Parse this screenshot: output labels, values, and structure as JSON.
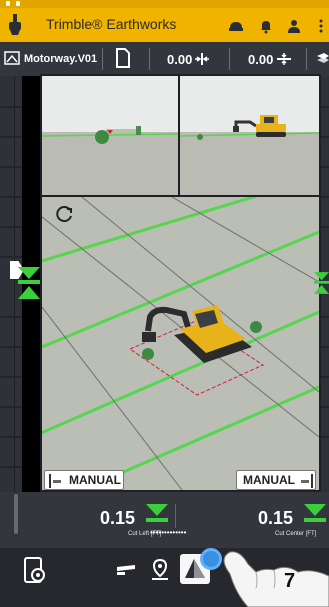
{
  "app": {
    "title": "Trimble® Earthworks"
  },
  "toolbar": {
    "design_name": "Motorway.V01",
    "offset_horizontal": "0.00",
    "offset_vertical": "0.00"
  },
  "views": {
    "left_mode": "MANUAL",
    "right_mode": "MANUAL"
  },
  "readouts": {
    "cut_left_value": "0.15",
    "cut_left_label": "Cut Left [FT]",
    "cut_center_value": "0.15",
    "cut_center_label": "Cut Center [FT]",
    "dots": "•••••••••••••"
  },
  "nav": {
    "step_number": "7"
  },
  "colors": {
    "brand": "#f0b300",
    "toolbar": "#33363d",
    "cut_arrow": "#3ccf3c",
    "design_line": "#56d64e"
  },
  "icons": {
    "app": "excavator-logo-icon",
    "titlebar": [
      "machine-icon",
      "bell-icon",
      "person-icon"
    ],
    "toolbar": [
      "design-icon",
      "file-icon",
      "horizontal-offset-icon",
      "vertical-offset-icon",
      "layers-icon"
    ],
    "nav": [
      "settings-device-icon",
      "blade-icon",
      "location-pin-icon",
      "3d-view-icon",
      "camera-icon"
    ]
  }
}
